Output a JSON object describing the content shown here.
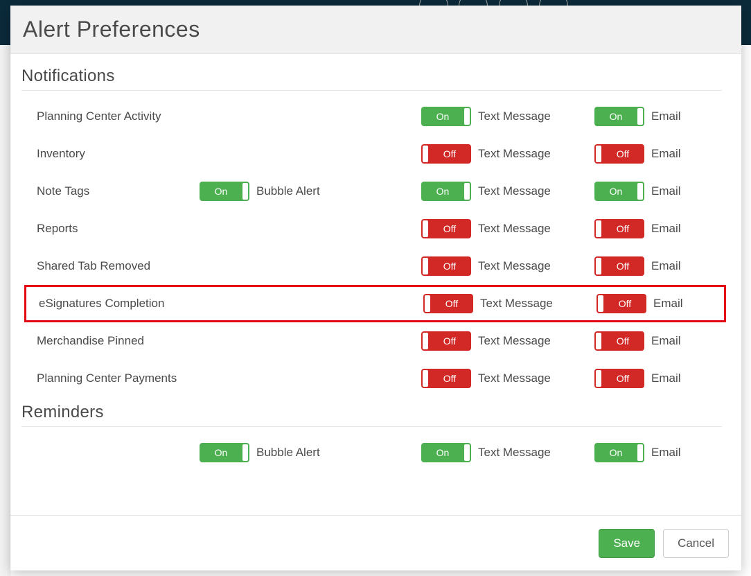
{
  "dialog": {
    "title": "Alert Preferences"
  },
  "labels": {
    "on": "On",
    "off": "Off",
    "bubble_alert": "Bubble Alert",
    "text_message": "Text Message",
    "email": "Email"
  },
  "sections": [
    {
      "title": "Notifications",
      "rows": [
        {
          "name": "Planning Center Activity",
          "bubble": null,
          "text": true,
          "email": true
        },
        {
          "name": "Inventory",
          "bubble": null,
          "text": false,
          "email": false
        },
        {
          "name": "Note Tags",
          "bubble": true,
          "text": true,
          "email": true
        },
        {
          "name": "Reports",
          "bubble": null,
          "text": false,
          "email": false
        },
        {
          "name": "Shared Tab Removed",
          "bubble": null,
          "text": false,
          "email": false
        },
        {
          "name": "eSignatures Completion",
          "bubble": null,
          "text": false,
          "email": false,
          "highlight": true
        },
        {
          "name": "Merchandise Pinned",
          "bubble": null,
          "text": false,
          "email": false
        },
        {
          "name": "Planning Center Payments",
          "bubble": null,
          "text": false,
          "email": false
        }
      ]
    },
    {
      "title": "Reminders",
      "rows": [
        {
          "name": "",
          "bubble": true,
          "text": true,
          "email": true
        }
      ]
    }
  ],
  "footer": {
    "save": "Save",
    "cancel": "Cancel"
  }
}
